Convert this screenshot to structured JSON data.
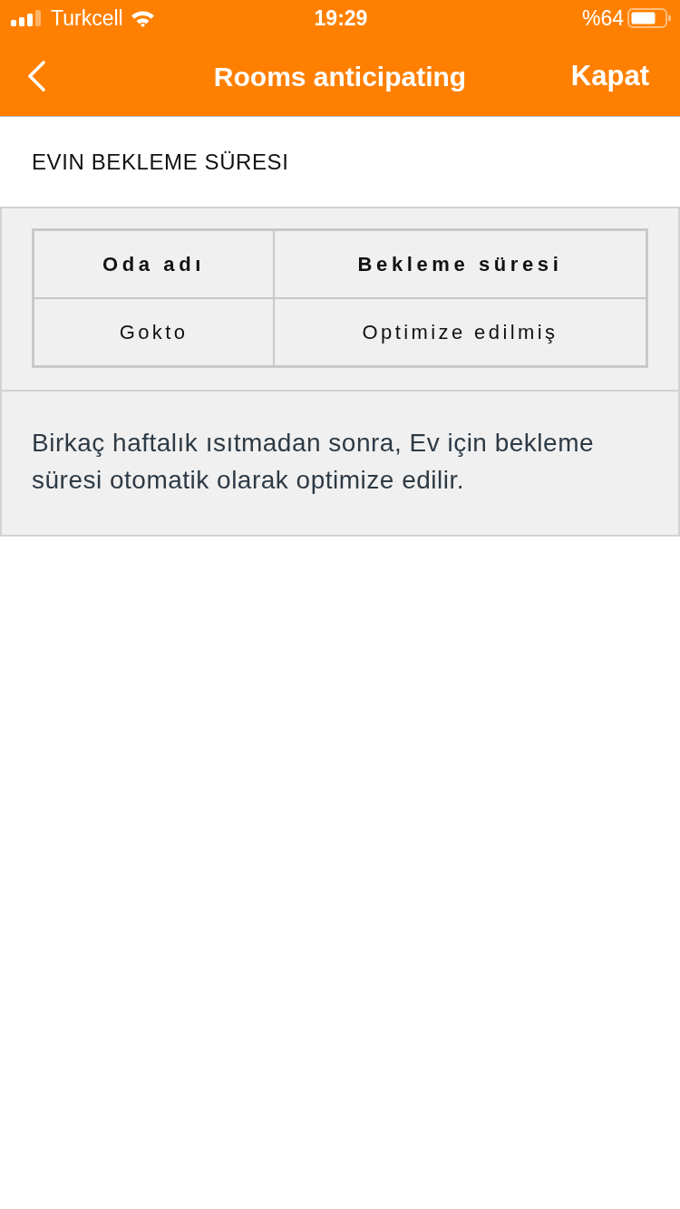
{
  "status_bar": {
    "carrier": "Turkcell",
    "time": "19:29",
    "battery": "%64"
  },
  "nav_bar": {
    "back": true,
    "title": "Rooms anticipating",
    "action": "Kapat"
  },
  "section_header": "EVIN BEKLEME SÜRESI",
  "table": {
    "columns": [
      "Oda adı",
      "Bekleme süresi"
    ],
    "rows": [
      [
        "Gokto",
        "Optimize edilmiş"
      ]
    ]
  },
  "note": "Birkaç haftalık ısıtmadan sonra, Ev için bekleme süresi otomatik olarak optimize edilir."
}
